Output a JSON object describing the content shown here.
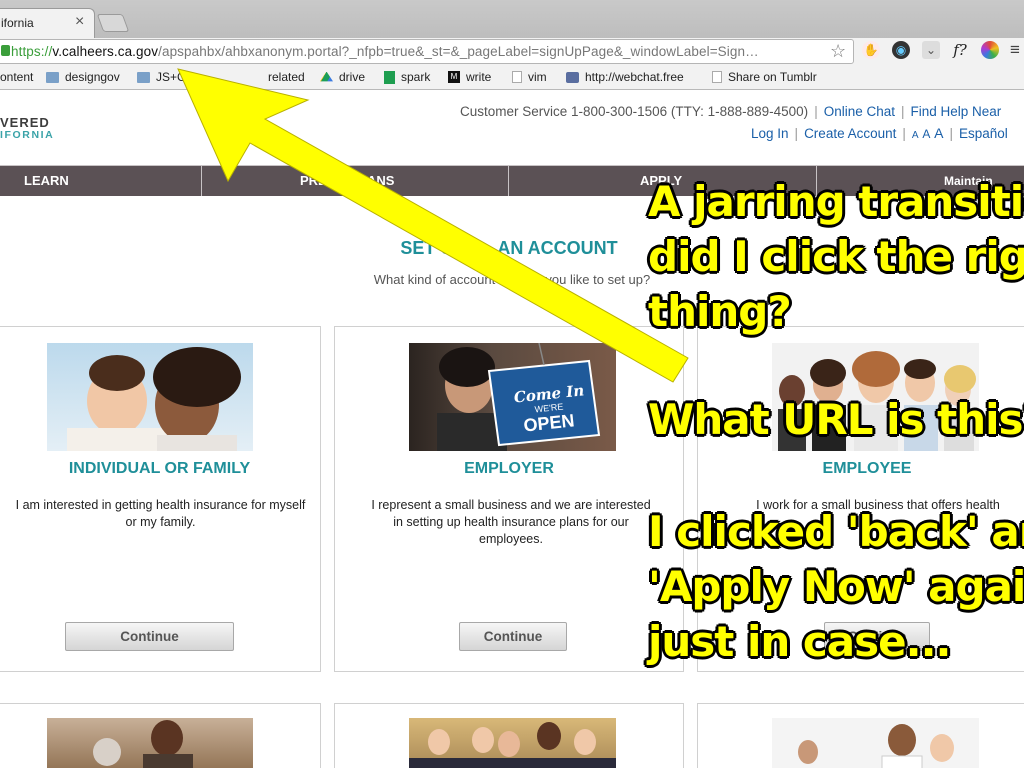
{
  "browser": {
    "tab_title": "ifornia",
    "url_scheme": "https",
    "url_host": "v.calheers.ca.gov",
    "url_rest": "/apspahbx/ahbxanonym.portal?_nfpb=true&_st=&_pageLabel=signUpPage&_windowLabel=Sign…",
    "extensions": [
      {
        "name": "hand-stop-icon",
        "glyph": "✋",
        "color": "#d02020"
      },
      {
        "name": "color-wheel-icon",
        "glyph": "◉",
        "color": "#333"
      },
      {
        "name": "pocket-icon",
        "glyph": "⌄",
        "color": "#666"
      },
      {
        "name": "font-finder-icon",
        "glyph": "f?",
        "color": "#222"
      },
      {
        "name": "rainbow-icon",
        "glyph": "●",
        "color": "#e04a3a"
      },
      {
        "name": "menu-icon",
        "glyph": "≡",
        "color": "#444"
      }
    ]
  },
  "bookmarks": [
    {
      "label": "ontent",
      "icon": "none"
    },
    {
      "label": "designgov",
      "icon": "folder"
    },
    {
      "label": "JS+C",
      "icon": "folder"
    },
    {
      "label": "related",
      "icon": "folder"
    },
    {
      "label": "drive",
      "icon": "drive"
    },
    {
      "label": "spark",
      "icon": "sheet"
    },
    {
      "label": "write",
      "icon": "medium"
    },
    {
      "label": "vim",
      "icon": "page"
    },
    {
      "label": "http://webchat.free",
      "icon": "globe"
    },
    {
      "label": "Share on Tumblr",
      "icon": "page"
    }
  ],
  "header": {
    "logo_line1": "VERED",
    "logo_line2": "IFORNIA",
    "customer_service": "Customer Service 1-800-300-1506 (TTY: 1-888-889-4500)",
    "online_chat": "Online Chat",
    "find_help": "Find Help Near",
    "log_in": "Log In",
    "create_account": "Create Account",
    "text_size_a1": "A",
    "text_size_a2": "A",
    "text_size_a3": "A",
    "espanol": "Español"
  },
  "nav": {
    "learn": "LEARN",
    "preview": "PREVI",
    "preview_tail": "ANS",
    "apply": "APPLY",
    "maintain": "Maintain"
  },
  "main": {
    "heading": "SET U",
    "heading_tail": "AN ACCOUNT",
    "subheading": "What kind of account wo",
    "subheading_tail": "you like to set up?",
    "cards": [
      {
        "title": "INDIVIDUAL OR FAMILY",
        "desc": "I am interested in getting health insurance for myself or my family.",
        "button": "Continue"
      },
      {
        "title": "EMPLOYER",
        "desc": "I represent a small business and we are interested in setting up health insurance plans for our employees.",
        "button": "Continue",
        "sign_line1": "Come In",
        "sign_line2": "WE'RE",
        "sign_line3": "OPEN"
      },
      {
        "title": "EMPLOYEE",
        "desc": "I work for a small business that offers health",
        "button": "Continue"
      }
    ]
  },
  "annotations": {
    "line1": "A jarring transitio",
    "line2": "did I click the righ",
    "line3": "thing?",
    "line4": "What URL is this?",
    "line5": "I clicked 'back' ar",
    "line6": "'Apply Now' agair",
    "line7": "just in case..."
  },
  "colors": {
    "accent_teal": "#1f8f99",
    "nav_bg": "#5b5155",
    "link_blue": "#1a5fa8",
    "annotation_yellow": "#ffff00"
  }
}
